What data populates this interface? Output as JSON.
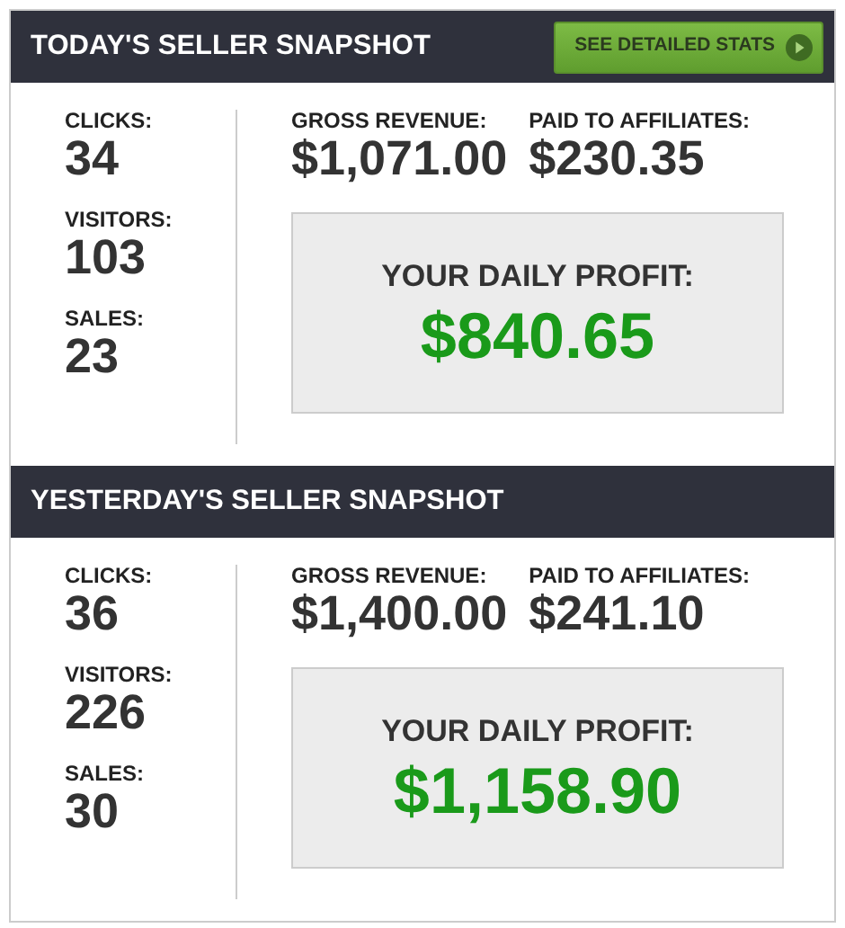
{
  "sections": [
    {
      "title": "TODAY'S SELLER SNAPSHOT",
      "button": "SEE DETAILED STATS",
      "stats": [
        {
          "label": "CLICKS:",
          "value": "34"
        },
        {
          "label": "VISITORS:",
          "value": "103"
        },
        {
          "label": "SALES:",
          "value": "23"
        }
      ],
      "revenue": [
        {
          "label": "GROSS REVENUE:",
          "value": "$1,071.00"
        },
        {
          "label": "PAID TO AFFILIATES:",
          "value": "$230.35"
        }
      ],
      "profit": {
        "label": "YOUR DAILY PROFIT:",
        "value": "$840.65"
      }
    },
    {
      "title": "YESTERDAY'S SELLER SNAPSHOT",
      "stats": [
        {
          "label": "CLICKS:",
          "value": "36"
        },
        {
          "label": "VISITORS:",
          "value": "226"
        },
        {
          "label": "SALES:",
          "value": "30"
        }
      ],
      "revenue": [
        {
          "label": "GROSS REVENUE:",
          "value": "$1,400.00"
        },
        {
          "label": "PAID TO AFFILIATES:",
          "value": "$241.10"
        }
      ],
      "profit": {
        "label": "YOUR DAILY PROFIT:",
        "value": "$1,158.90"
      }
    }
  ]
}
